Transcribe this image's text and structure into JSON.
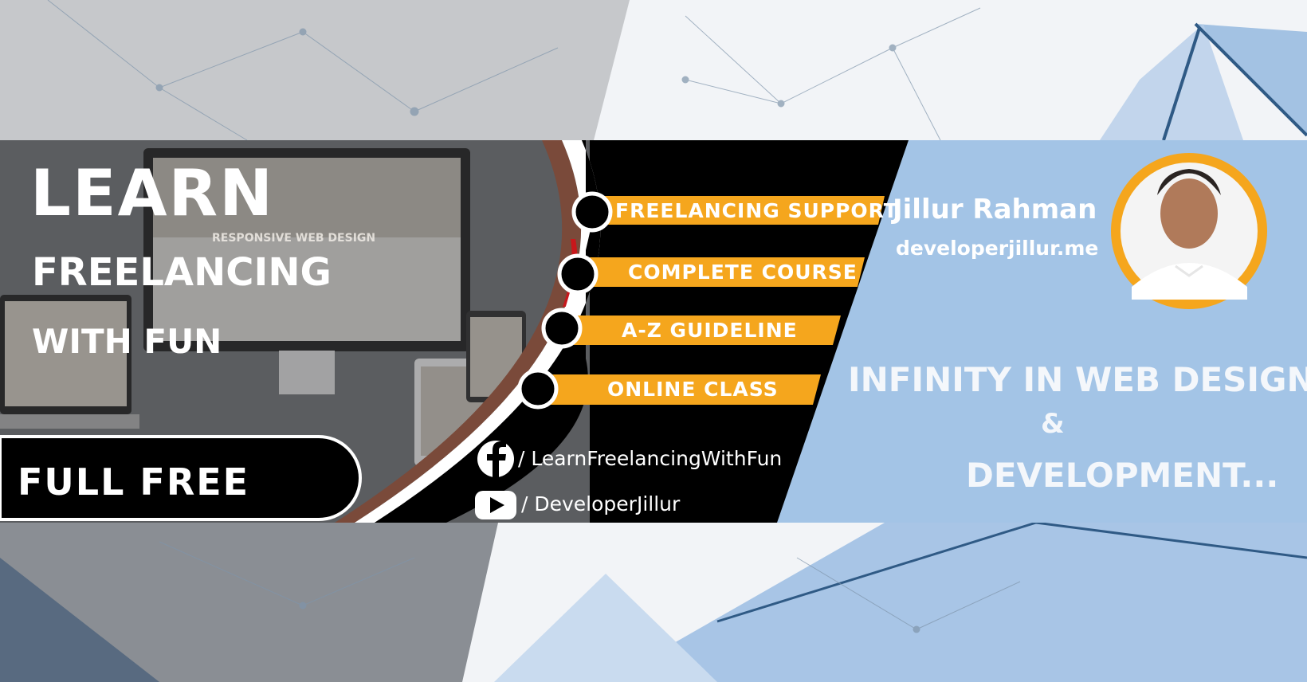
{
  "headline": {
    "line1": "LEARN",
    "line2": "FREELANCING",
    "line3": "WITH FUN"
  },
  "screen_caption": "RESPONSIVE WEB DESIGN",
  "badge": {
    "label": "FULL  FREE"
  },
  "features": [
    "FREELANCING  SUPPORT",
    "COMPLETE  COURSE",
    "A-Z   GUIDELINE",
    "ONLINE   CLASS"
  ],
  "social": {
    "facebook": {
      "icon": "facebook-icon",
      "text": "/ LearnFreelancingWithFun"
    },
    "youtube": {
      "icon": "youtube-icon",
      "text": "/ DeveloperJillur"
    }
  },
  "author": {
    "name": "Jillur Rahman",
    "website": "developerjillur.me"
  },
  "tagline": {
    "line1": "INFINITY IN WEB DESIGN",
    "line2": "&",
    "line3": "DEVELOPMENT..."
  },
  "colors": {
    "accent": "#f5a61d",
    "panel": "#a3c4e6",
    "dark": "#000000"
  }
}
